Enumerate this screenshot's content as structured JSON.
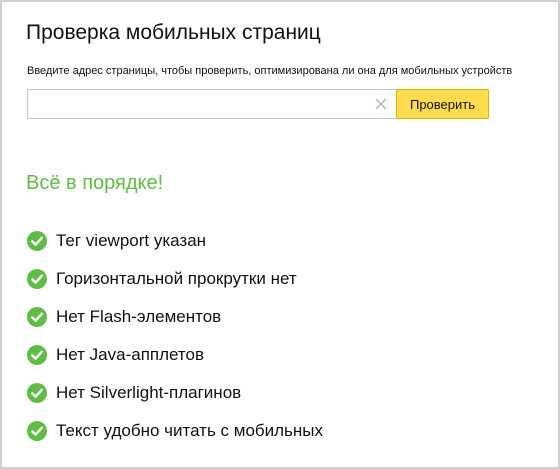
{
  "header": {
    "title": "Проверка мобильных страниц",
    "description": "Введите адрес страницы, чтобы проверить, оптимизирована ли она для мобильных устройств"
  },
  "form": {
    "url_value": "",
    "url_placeholder": "",
    "clear_icon": "close-icon",
    "submit_label": "Проверить"
  },
  "result": {
    "heading": "Всё в порядке!",
    "status_color": "#5fbd45",
    "checks": [
      {
        "label": "Тег viewport указан",
        "icon": "check-circle-icon",
        "passed": true
      },
      {
        "label": "Горизонтальной прокрутки нет",
        "icon": "check-circle-icon",
        "passed": true
      },
      {
        "label": "Нет Flash-элементов",
        "icon": "check-circle-icon",
        "passed": true
      },
      {
        "label": "Нет Java-апплетов",
        "icon": "check-circle-icon",
        "passed": true
      },
      {
        "label": "Нет Silverlight-плагинов",
        "icon": "check-circle-icon",
        "passed": true
      },
      {
        "label": "Текст удобно читать с мобильных",
        "icon": "check-circle-icon",
        "passed": true
      }
    ]
  },
  "colors": {
    "accent_button": "#ffdb4d",
    "check_green": "#5fbd45",
    "text": "#111111"
  }
}
